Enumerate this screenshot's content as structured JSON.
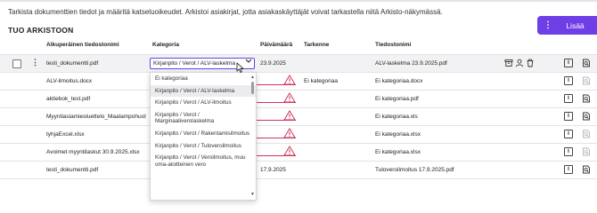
{
  "intro_text": "Tarkista dokumenttien tiedot ja määritä katseluoikeudet. Arkistoi asiakirjat, jotta asiakaskäyttäjät voivat tarkastella niitä Arkisto-näkymässä.",
  "section_title": "TUO ARKISTOON",
  "add_button": {
    "dots": "⋮",
    "label": "Lisää"
  },
  "columns": {
    "filename": "Alkuperäinen tiedostonimi",
    "category": "Kategoria",
    "date": "Päivämäärä",
    "detail": "Tarkenne",
    "target": "Tiedostonimi"
  },
  "rows": [
    {
      "filename": "testi_dokumentti.pdf",
      "category": "Kirjanpito / Verot / ALV-laskelma",
      "date": "23.9.2025",
      "detail": "",
      "target": "ALV-laskelma 23.9.2025.pdf"
    },
    {
      "filename": "ALV-ilmoitus.docx",
      "category": "",
      "date": "",
      "detail": "Ei kategoriaa",
      "target": "Ei kategoriaa.docx"
    },
    {
      "filename": "aktiebok_test.pdf",
      "category": "",
      "date": "",
      "detail": "",
      "target": "Ei kategoriaa.pdf"
    },
    {
      "filename": "Myyntiasiamiesluettelo_Maalampohuol...",
      "category": "",
      "date": "",
      "detail": "",
      "target": "Ei kategoriaa.xls"
    },
    {
      "filename": "tyhjaExcel.xlsx",
      "category": "",
      "date": "",
      "detail": "",
      "target": "Ei kategoriaa.xlsx"
    },
    {
      "filename": "Avoimet myyntilaskut 30.9.2025.xlsx",
      "category": "",
      "date": "",
      "detail": "",
      "target": "Ei kategoriaa.xlsx"
    },
    {
      "filename": "testi_dokumentti.pdf",
      "category": "",
      "date": "17.9.2025",
      "detail": "",
      "target": "Tuloveroilmoitus 17.9.2025.pdf"
    }
  ],
  "dropdown_options": [
    "Ei kategoriaa",
    "Kirjanpito / Verot / ALV-laskelma",
    "Kirjanpito / Verot / ALV-ilmoitus",
    "Kirjanpito / Verot / Marginaaliverolaskelma",
    "Kirjanpito / Verot / Rakentamisilmoitus",
    "Kirjanpito / Verot / Tuloveroilmoitus",
    "Kirjanpito / Verot / Veroilmoitus, muu oma-aloitteinen vero"
  ],
  "colors": {
    "accent": "#6e3fe6",
    "warning": "#d0345a"
  }
}
